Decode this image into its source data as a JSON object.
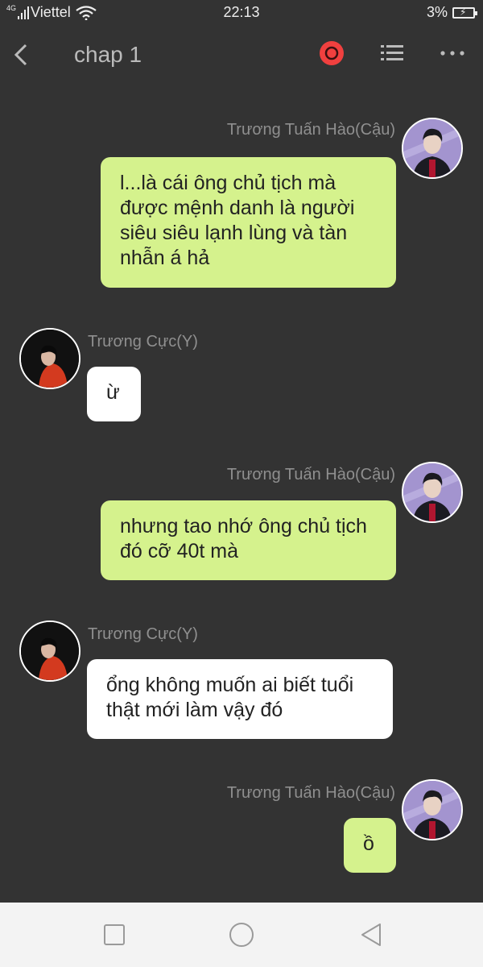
{
  "status_bar": {
    "network": "4G",
    "carrier": "Viettel",
    "time": "22:13",
    "battery": "3%",
    "battery_level": 0.03
  },
  "header": {
    "title": "chap 1",
    "icons": [
      "back-arrow-icon",
      "record-icon",
      "list-icon",
      "more-icon"
    ]
  },
  "colors": {
    "background": "#333333",
    "sent_bubble": "#d5f28d",
    "received_bubble": "#ffffff",
    "record_accent": "#f0403f"
  },
  "messages": [
    {
      "sender": "Trương Tuấn Hào(Cậu)",
      "side": "right",
      "text": "l...là cái ông chủ tịch mà được mệnh danh là người siêu siêu lạnh lùng và tàn nhẫn á hả"
    },
    {
      "sender": "Trương Cực(Y)",
      "side": "left",
      "text": "ừ"
    },
    {
      "sender": "Trương Tuấn Hào(Cậu)",
      "side": "right",
      "text": "nhưng tao nhớ ông chủ tịch đó cỡ 40t mà"
    },
    {
      "sender": "Trương Cực(Y)",
      "side": "left",
      "text": "ổng không muốn ai biết tuổi thật mới làm vậy đó"
    },
    {
      "sender": "Trương Tuấn Hào(Cậu)",
      "side": "right",
      "text": "ồ"
    }
  ],
  "nav_bar": {
    "icons": [
      "recent-apps-icon",
      "home-icon",
      "back-icon"
    ]
  }
}
